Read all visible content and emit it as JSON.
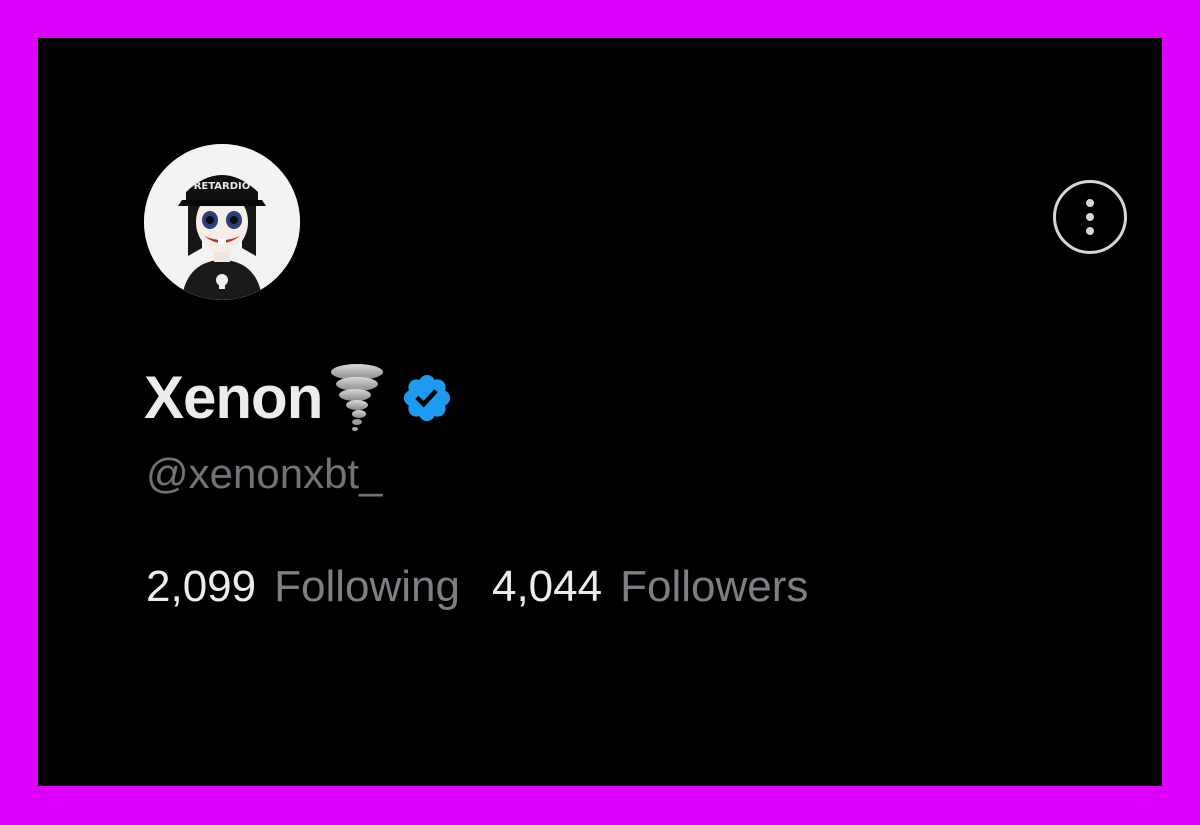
{
  "profile": {
    "display_name": "Xenon",
    "name_emoji": "tornado-icon",
    "verified": true,
    "verified_color": "#1d9bf0",
    "handle": "@xenonxbt_",
    "avatar_cap_text": "RETARDIO"
  },
  "stats": {
    "following_count": "2,099",
    "following_label": "Following",
    "followers_count": "4,044",
    "followers_label": "Followers"
  },
  "actions": {
    "more_icon": "more-vertical-icon"
  },
  "colors": {
    "background": "#000000",
    "border": "#de00ff",
    "primary_text": "#ececec",
    "secondary_text": "#71767b"
  }
}
